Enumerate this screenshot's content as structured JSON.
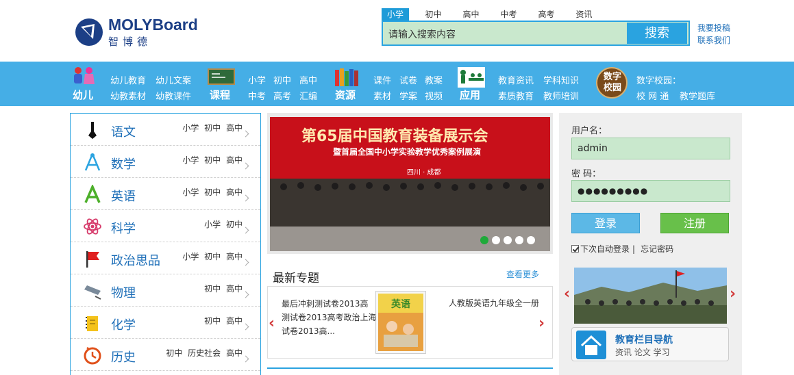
{
  "logo": {
    "name": "MOLYBoard",
    "cn": "智博德"
  },
  "search": {
    "tabs": [
      "小学",
      "初中",
      "高中",
      "中考",
      "高考",
      "资讯"
    ],
    "placeholder": "请输入搜索内容",
    "button": "搜索"
  },
  "header_links": [
    "我要投稿",
    "联系我们"
  ],
  "nav": [
    {
      "label": "幼儿",
      "links": [
        "幼儿教育",
        "幼儿文案",
        "幼教素材",
        "幼教课件"
      ]
    },
    {
      "label": "课程",
      "links": [
        "小学",
        "初中",
        "高中",
        "中考",
        "高考",
        "汇编"
      ]
    },
    {
      "label": "资源",
      "links": [
        "课件",
        "试卷",
        "教案",
        "素材",
        "学案",
        "视频"
      ]
    },
    {
      "label": "应用",
      "links": [
        "教育资讯",
        "学科知识",
        "素质教育",
        "教师培训"
      ]
    },
    {
      "label": "数字校园",
      "links": [
        "数字校园：",
        "校 网 通",
        "教学题库"
      ]
    }
  ],
  "subjects": [
    {
      "name": "语文",
      "levels": "小学 初中 高中"
    },
    {
      "name": "数学",
      "levels": "小学 初中 高中"
    },
    {
      "name": "英语",
      "levels": "小学 初中 高中"
    },
    {
      "name": "科学",
      "levels": "小学 初中"
    },
    {
      "name": "政治思品",
      "levels": "小学 初中 高中"
    },
    {
      "name": "物理",
      "levels": "初中 高中"
    },
    {
      "name": "化学",
      "levels": "初中 高中"
    },
    {
      "name": "历史",
      "levels": "初中 历史社会 高中"
    }
  ],
  "banner": {
    "headline": "第65届中国教育装备展示会",
    "subline": "暨首届全国中小学实验教学优秀案例展演",
    "tag": "四川 · 成都"
  },
  "topics": {
    "title": "最新专题",
    "more": "查看更多",
    "item1_lines": [
      "最后冲刺测试卷2013高",
      "测试卷2013高考政治上海",
      "试卷2013高..."
    ],
    "book_title": "英语",
    "item2": "人教版英语九年级全一册"
  },
  "login": {
    "user_label": "用户名：",
    "user_value": "admin",
    "pass_label": "密  码：",
    "pass_value": "●●●●●●●●●",
    "login_btn": "登录",
    "register_btn": "注册",
    "remember": "下次自动登录",
    "forgot": "忘记密码"
  },
  "guide": {
    "title": "教育栏目导航",
    "sub": "资讯 论文 学习"
  },
  "colors": {
    "nav": "#45aee6",
    "accent": "#2aa3e0",
    "green": "#68c04a",
    "field": "#c9e8cd"
  }
}
